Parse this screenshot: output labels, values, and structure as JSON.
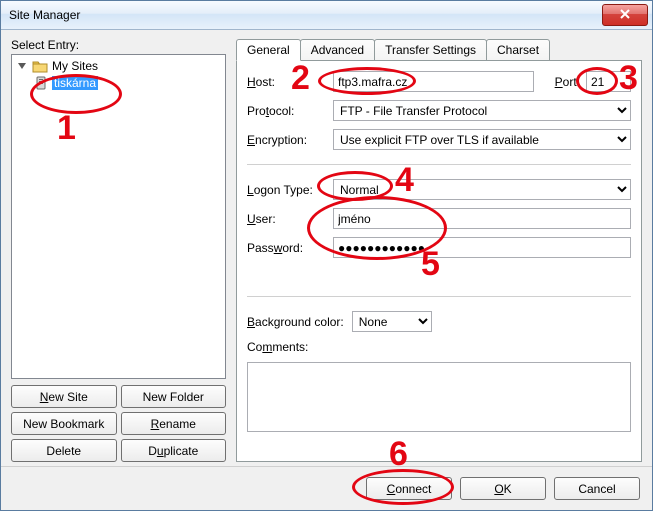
{
  "window": {
    "title": "Site Manager"
  },
  "left": {
    "select_entry_label": "Select Entry:",
    "root_label": "My Sites",
    "child_label": "tiskárna",
    "buttons": {
      "new_site": "New Site",
      "new_folder": "New Folder",
      "new_bookmark": "New Bookmark",
      "rename": "Rename",
      "delete": "Delete",
      "duplicate": "Duplicate"
    }
  },
  "tabs": {
    "general": "General",
    "advanced": "Advanced",
    "transfer": "Transfer Settings",
    "charset": "Charset"
  },
  "fields": {
    "host_label": "Host:",
    "host_value": "ftp3.mafra.cz",
    "port_label": "Port:",
    "port_value": "21",
    "protocol_label": "Protocol:",
    "protocol_value": "FTP - File Transfer Protocol",
    "encryption_label": "Encryption:",
    "encryption_value": "Use explicit FTP over TLS if available",
    "logon_label": "Logon Type:",
    "logon_value": "Normal",
    "user_label": "User:",
    "user_value": "jméno",
    "password_label": "Password:",
    "password_value": "●●●●●●●●●●●●",
    "bgcolor_label": "Background color:",
    "bgcolor_value": "None",
    "comments_label": "Comments:",
    "comments_value": ""
  },
  "bottom": {
    "connect": "Connect",
    "ok": "OK",
    "cancel": "Cancel"
  },
  "annotations": {
    "n1": "1",
    "n2": "2",
    "n3": "3",
    "n4": "4",
    "n5": "5",
    "n6": "6"
  }
}
